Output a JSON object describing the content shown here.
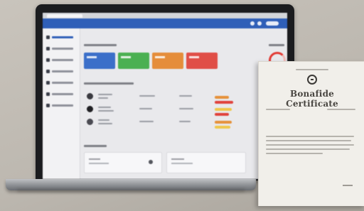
{
  "scene": {
    "description_kind": "photo of a laptop showing an admin dashboard next to a printed certificate",
    "colors": {
      "background": "#c2bdb5",
      "laptop_bezel": "#1b1c1f",
      "dashboard_header": "#2f5fb8",
      "tile_blue": "#3b6fc9",
      "tile_green": "#4bb052",
      "tile_orange": "#e58d3a",
      "tile_red": "#e04e47",
      "progress_ring": "#e23a34",
      "certificate_paper": "#f1efea"
    }
  },
  "certificate": {
    "title": "Bonafide Certificate",
    "emblem_icon": "graduation-cap-icon"
  }
}
